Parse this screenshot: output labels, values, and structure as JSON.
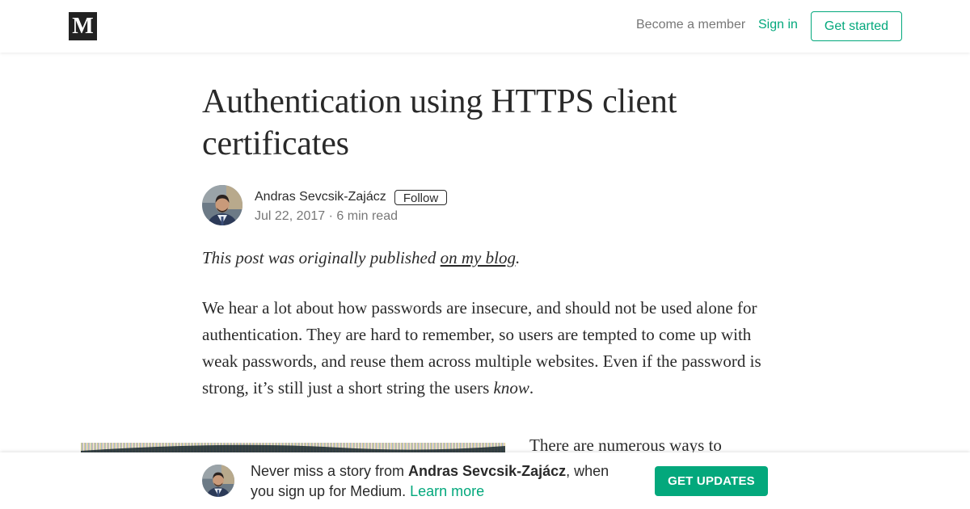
{
  "brand": {
    "logo_letter": "M",
    "accent_color": "#03a87c"
  },
  "nav": {
    "become_member": "Become a member",
    "sign_in": "Sign in",
    "get_started": "Get started"
  },
  "article": {
    "title": "Authentication using HTTPS client certificates",
    "author": {
      "name": "Andras Sevcsik-Zajácz",
      "follow_label": "Follow",
      "date": "Jul 22, 2017",
      "separator": " · ",
      "read_time": "6 min read"
    },
    "intro": {
      "prefix": "This post was originally published ",
      "link_text": "on my blog",
      "suffix": "."
    },
    "paragraph": {
      "text": "We hear a lot about how passwords are insecure, and should not be used alone for authentication. They are hard to remember, so users are tempted to come up with weak passwords, and reuse them across multiple websites. Even if the password is strong, it’s still just a short string the users ",
      "emphasis": "know",
      "end": "."
    },
    "side_text": "There are numerous ways to"
  },
  "banner": {
    "prefix": "Never miss a story from ",
    "author": "Andras Sevcsik-Zajácz",
    "middle": ", when you sign up for Medium. ",
    "learn_more": "Learn more",
    "button": "GET UPDATES"
  }
}
